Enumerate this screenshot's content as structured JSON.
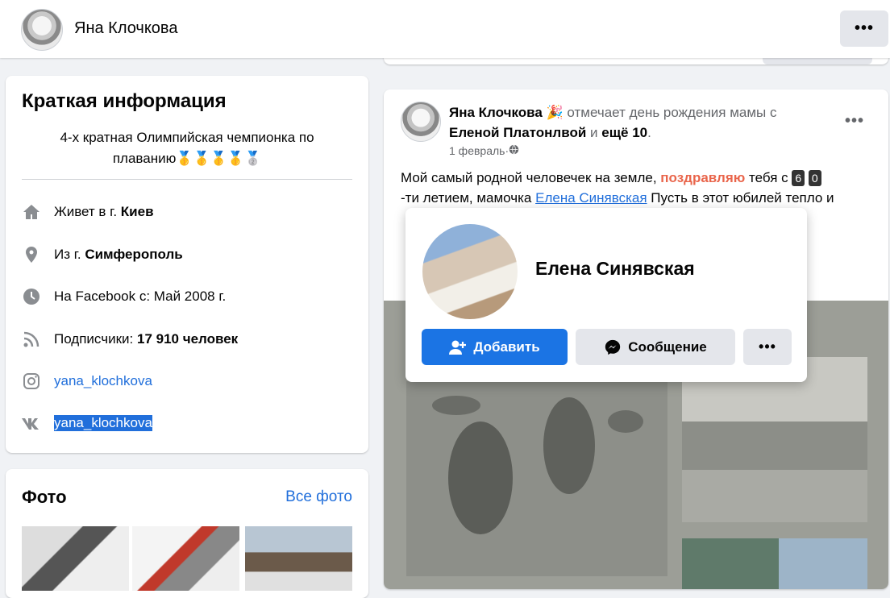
{
  "header": {
    "name": "Яна Клочкова",
    "more_label": "•••"
  },
  "intro": {
    "title": "Краткая информация",
    "bio": "4-х кратная Олимпийская чемпионка по плаванию🥇🥇🥇🥇🥈",
    "lives_prefix": "Живет в г. ",
    "lives_city": "Киев",
    "from_prefix": "Из г. ",
    "from_city": "Симферополь",
    "joined": "На Facebook с: Май 2008 г.",
    "followers_prefix": "Подписчики: ",
    "followers_count": "17 910 человек",
    "instagram": "yana_klochkova",
    "vk": "yana_klochkova"
  },
  "photos": {
    "title": "Фото",
    "all_link": "Все фото"
  },
  "post": {
    "author": "Яна Клочкова",
    "emoji": "🎉",
    "action": " отмечает день рождения мамы с ",
    "with_name": "Еленой Платонлвой",
    "and": " и ",
    "more": "ещё 10",
    "period": ".",
    "date": "1 февраль",
    "sep": " · ",
    "more_label": "•••",
    "text_1": "Мой самый родной человечек на земле, ",
    "text_red": "поздравляю",
    "text_2": " тебя с ",
    "num_6": "6",
    "num_0": "0",
    "text_3": " -ти летием, мамочка ",
    "text_link": "Елена Синявская",
    "text_4": " Пусть в этот юбилей тепло и"
  },
  "hovercard": {
    "name": "Елена Синявская",
    "add_label": "Добавить",
    "message_label": "Сообщение",
    "more_label": "•••"
  }
}
